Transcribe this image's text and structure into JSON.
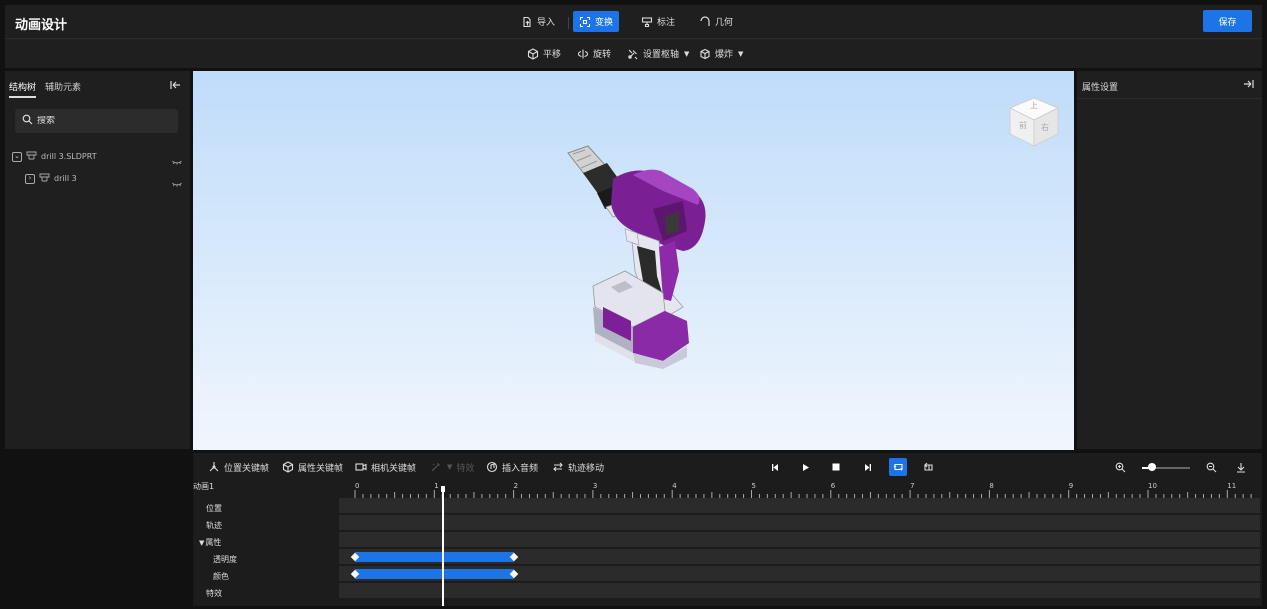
{
  "header": {
    "title": "动画设计",
    "buttons": [
      {
        "label": "导入",
        "icon": "import-icon"
      },
      {
        "label": "变换",
        "icon": "transform-icon",
        "active": true
      },
      {
        "label": "标注",
        "icon": "annotate-icon"
      },
      {
        "label": "几何",
        "icon": "geometry-icon"
      }
    ],
    "save_label": "保存"
  },
  "subtoolbar": {
    "items": [
      {
        "label": "平移",
        "icon": "move-icon"
      },
      {
        "label": "旋转",
        "icon": "rotate-icon"
      },
      {
        "label": "设置枢轴",
        "icon": "pivot-icon",
        "has_dropdown": true
      },
      {
        "label": "爆炸",
        "icon": "explode-icon",
        "has_dropdown": true
      }
    ]
  },
  "left_panel": {
    "tabs": [
      "结构树",
      "辅助元素"
    ],
    "active_tab": "结构树",
    "search_placeholder": "搜索",
    "tree": [
      {
        "label": "drill 3.SLDPRT",
        "expanded": true
      },
      {
        "label": "drill 3",
        "expanded": false
      }
    ]
  },
  "viewport": {
    "view_cube": {
      "top": "上",
      "front": "前",
      "right": "右"
    }
  },
  "right_panel": {
    "title": "属性设置"
  },
  "timeline": {
    "toolbar": {
      "items": [
        {
          "label": "位置关键帧",
          "icon": "position-keyframe-icon"
        },
        {
          "label": "属性关键帧",
          "icon": "property-keyframe-icon"
        },
        {
          "label": "相机关键帧",
          "icon": "camera-keyframe-icon"
        },
        {
          "label": "特效",
          "icon": "effect-icon",
          "disabled": true
        },
        {
          "label": "插入音频",
          "icon": "audio-icon"
        },
        {
          "label": "轨迹移动",
          "icon": "trajectory-icon"
        }
      ]
    },
    "playback": {
      "loop_active": true
    },
    "zoom": {
      "level": 0.2
    },
    "animation_name": "动画1",
    "ruler_labels": [
      "0",
      "1",
      "2",
      "3",
      "4",
      "5",
      "6",
      "7",
      "8",
      "9",
      "10",
      "11"
    ],
    "playhead_time": 1.1,
    "tracks": [
      {
        "label": "位置"
      },
      {
        "label": "轨迹"
      },
      {
        "label": "属性",
        "group": true
      },
      {
        "label": "透明度",
        "keyframes": [
          0,
          2
        ]
      },
      {
        "label": "颜色",
        "keyframes": [
          0,
          2
        ]
      },
      {
        "label": "特效"
      }
    ]
  },
  "colors": {
    "accent": "#1d74e6",
    "panel": "#1f1f1f",
    "lane": "#2b2b2b"
  }
}
